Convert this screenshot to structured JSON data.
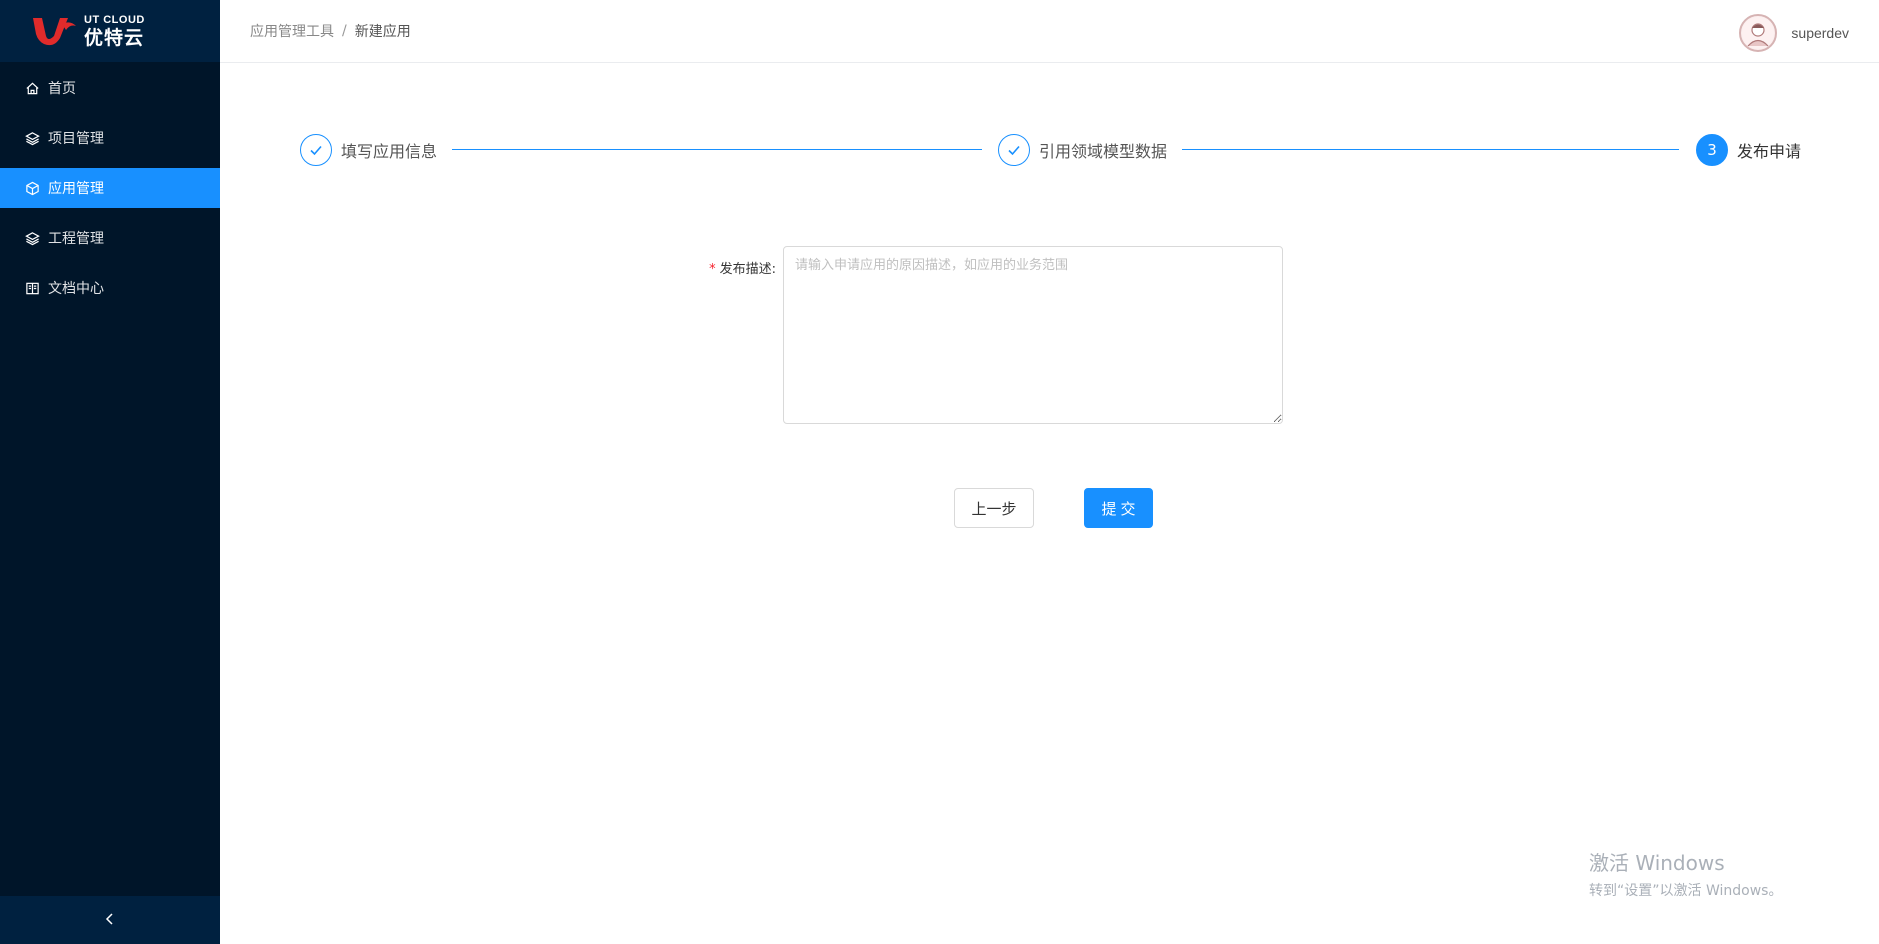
{
  "brand": {
    "name_en": "UT CLOUD",
    "name_cn": "优特云",
    "primary_color": "#1890ff",
    "sidebar_color": "#001529"
  },
  "sidebar": {
    "items": [
      {
        "label": "首页",
        "icon": "home-icon",
        "active": false
      },
      {
        "label": "项目管理",
        "icon": "layers-icon",
        "active": false
      },
      {
        "label": "应用管理",
        "icon": "cube-icon",
        "active": true
      },
      {
        "label": "工程管理",
        "icon": "layers-icon",
        "active": false
      },
      {
        "label": "文档中心",
        "icon": "book-icon",
        "active": false
      }
    ],
    "collapse_icon": "chevron-left-icon"
  },
  "header": {
    "breadcrumb": [
      "应用管理工具",
      "新建应用"
    ],
    "breadcrumb_separator": "/",
    "user": {
      "name": "superdev",
      "avatar_icon": "avatar-icon"
    }
  },
  "steps": [
    {
      "title": "填写应用信息",
      "status": "finish",
      "icon": "check-icon"
    },
    {
      "title": "引用领域模型数据",
      "status": "finish",
      "icon": "check-icon"
    },
    {
      "number": "3",
      "title": "发布申请",
      "status": "process"
    }
  ],
  "form": {
    "description": {
      "required_mark": "*",
      "label": "发布描述:",
      "value": "",
      "placeholder": "请输入申请应用的原因描述，如应用的业务范围"
    }
  },
  "actions": {
    "prev_label": "上一步",
    "submit_label": "提交"
  },
  "watermark": {
    "title": "激活 Windows",
    "subtitle": "转到“设置”以激活 Windows。"
  }
}
